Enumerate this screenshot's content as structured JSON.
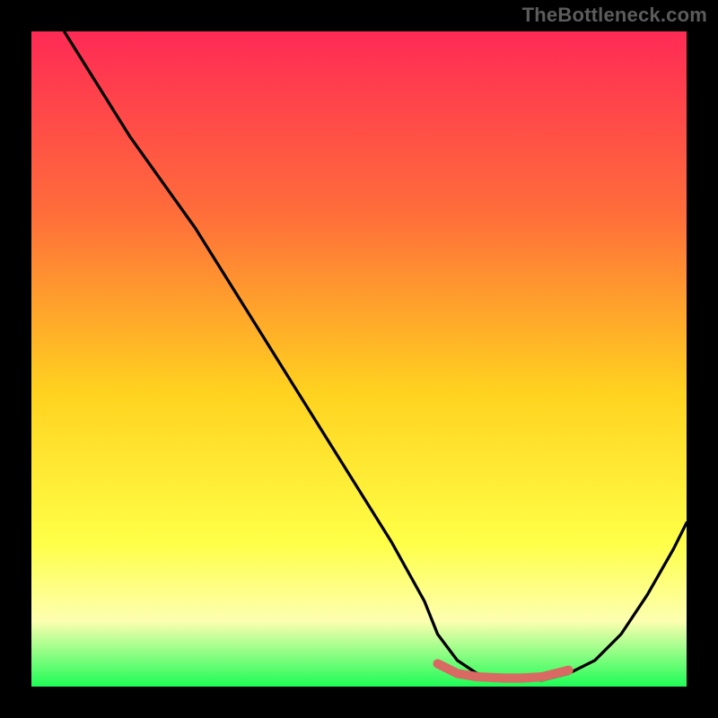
{
  "watermark": "TheBottleneck.com",
  "colors": {
    "grad_top": "#ff2a55",
    "grad_mid_upper": "#ff6e3a",
    "grad_mid": "#ffd21f",
    "grad_mid_lower": "#ffff47",
    "grad_pale": "#fdffb0",
    "grad_green": "#1efc57",
    "curve": "#000000",
    "marker": "#d86a63",
    "background": "#000000"
  },
  "chart_data": {
    "type": "line",
    "title": "",
    "xlabel": "",
    "ylabel": "",
    "xlim": [
      0,
      100
    ],
    "ylim": [
      0,
      100
    ],
    "series": [
      {
        "name": "bottleneck-curve",
        "x": [
          5,
          10,
          15,
          20,
          25,
          30,
          35,
          40,
          45,
          50,
          55,
          60,
          62,
          65,
          68,
          72,
          75,
          78,
          82,
          86,
          90,
          94,
          98,
          100
        ],
        "values": [
          100,
          92,
          84,
          77,
          70,
          62,
          54,
          46,
          38,
          30,
          22,
          13,
          8,
          4,
          2,
          1,
          1,
          1,
          2,
          4,
          8,
          14,
          21,
          25
        ]
      },
      {
        "name": "bottleneck-flat-marker",
        "x": [
          62,
          65,
          68,
          72,
          75,
          78,
          82
        ],
        "values": [
          3.5,
          2,
          1.5,
          1.3,
          1.3,
          1.5,
          2.5
        ]
      }
    ],
    "gradient_stops": [
      {
        "pct": 0,
        "color": "#ff2a55"
      },
      {
        "pct": 28,
        "color": "#ff6e3a"
      },
      {
        "pct": 55,
        "color": "#ffd21f"
      },
      {
        "pct": 78,
        "color": "#ffff47"
      },
      {
        "pct": 90,
        "color": "#fdffb0"
      },
      {
        "pct": 100,
        "color": "#1efc57"
      }
    ]
  }
}
